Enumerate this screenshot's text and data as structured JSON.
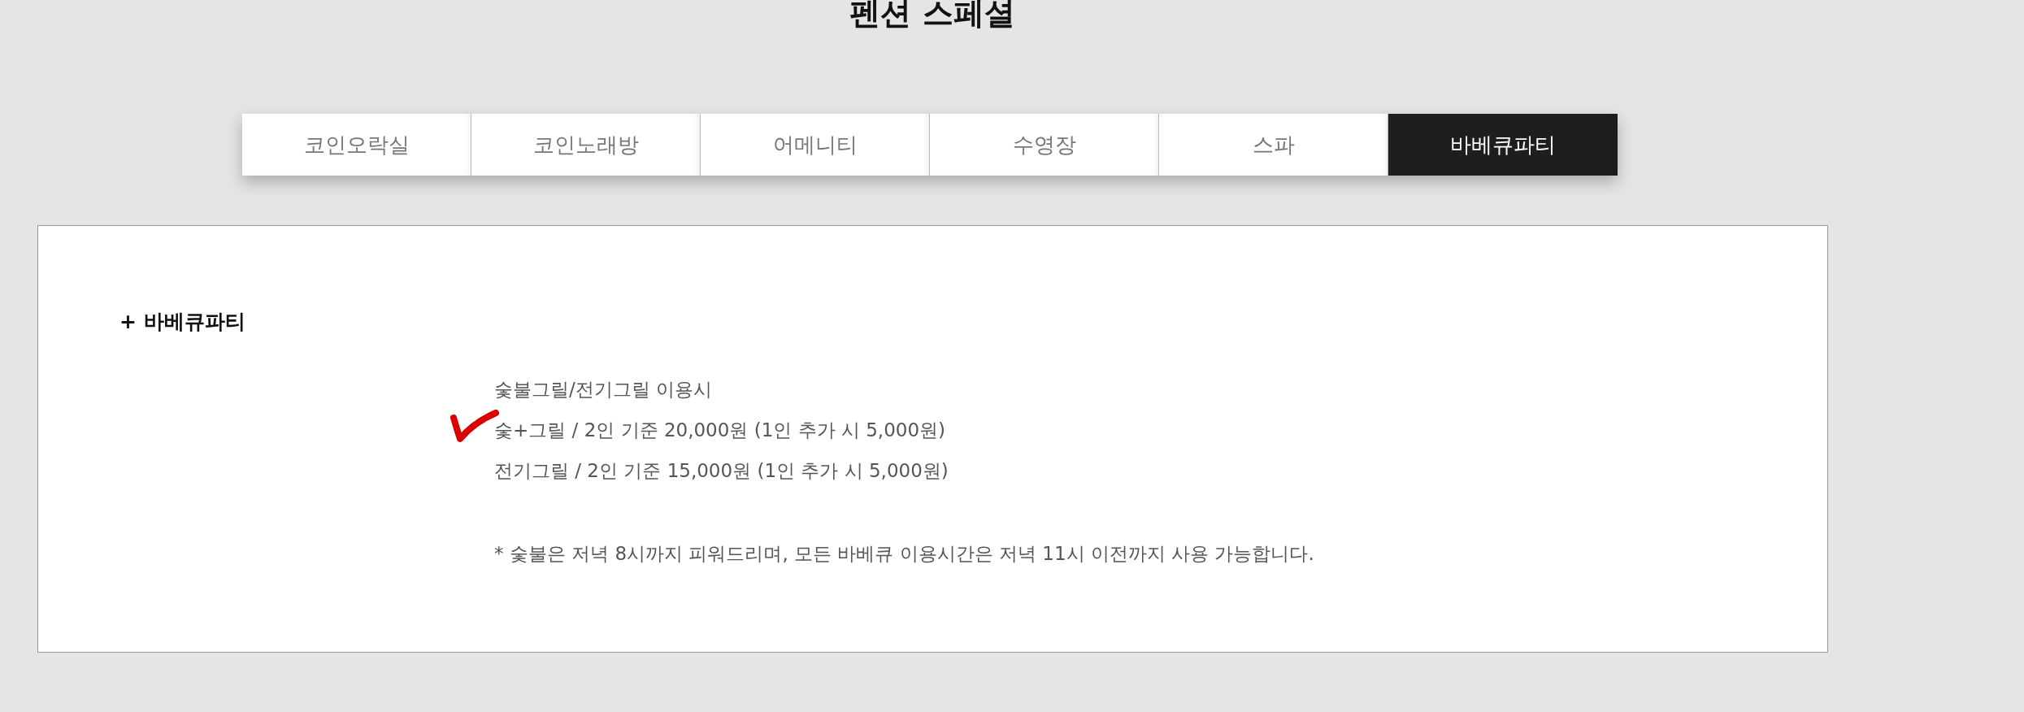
{
  "title": "펜션 스페셜",
  "tabs": [
    {
      "label": "코인오락실",
      "selected": false
    },
    {
      "label": "코인노래방",
      "selected": false
    },
    {
      "label": "어메니티",
      "selected": false
    },
    {
      "label": "수영장",
      "selected": false
    },
    {
      "label": "스파",
      "selected": false
    },
    {
      "label": "바베큐파티",
      "selected": true
    }
  ],
  "section": {
    "heading": "+ 바베큐파티",
    "lines": [
      {
        "text": "숯불그릴/전기그릴 이용시",
        "marked": false
      },
      {
        "text": "숯+그릴 / 2인 기준 20,000원 (1인 추가 시 5,000원)",
        "marked": true
      },
      {
        "text": "전기그릴 / 2인 기준 15,000원 (1인 추가 시 5,000원)",
        "marked": false
      }
    ],
    "note": "* 숯불은 저녁 8시까지 피워드리며, 모든 바베큐 이용시간은 저녁 11시 이전까지 사용 가능합니다."
  }
}
